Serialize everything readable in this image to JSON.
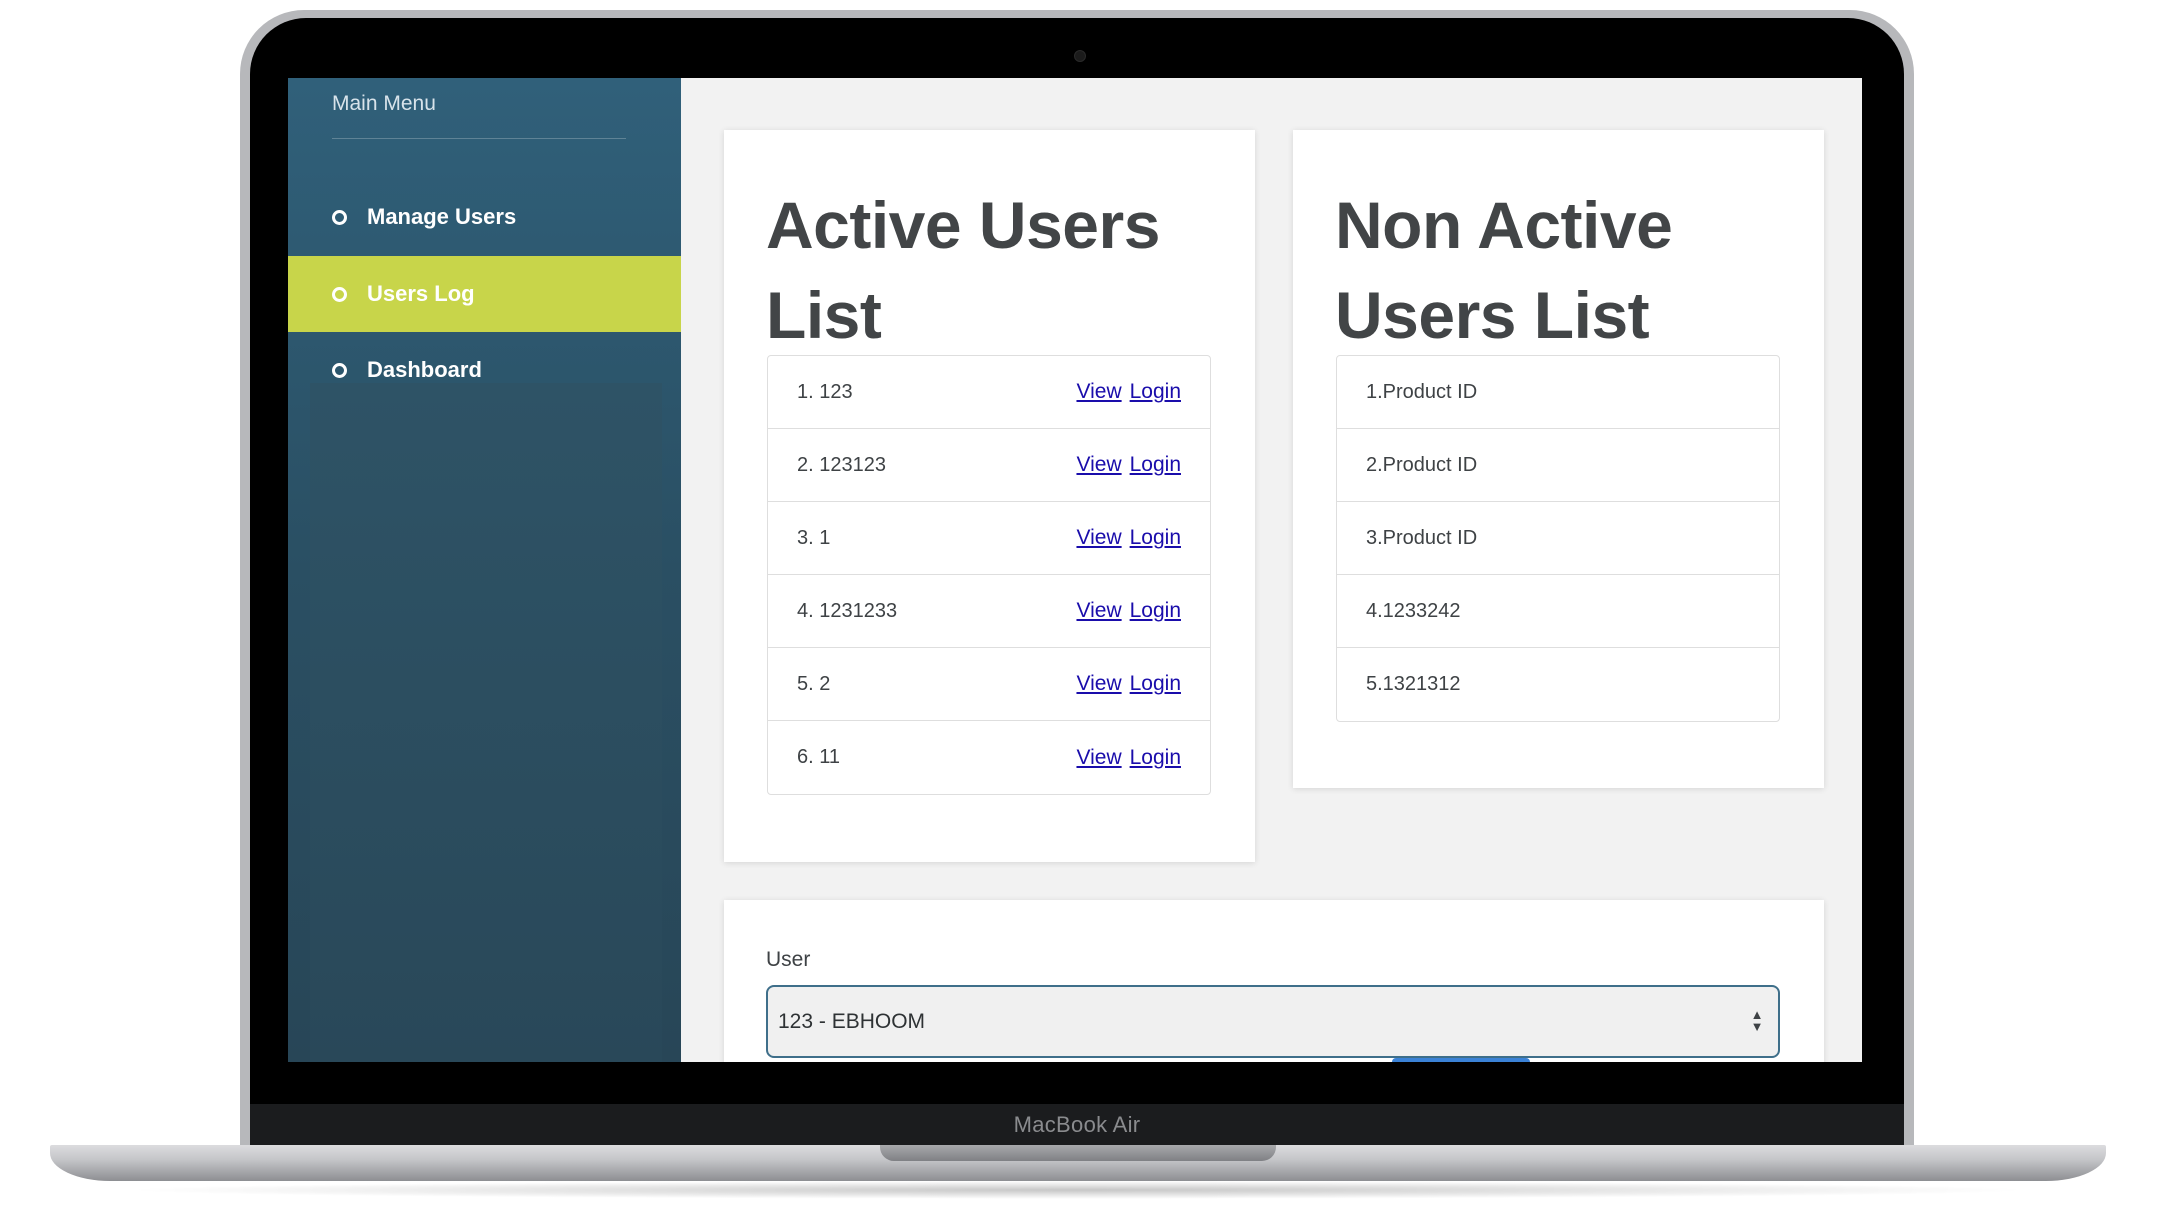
{
  "device": {
    "brand_label": "MacBook Air"
  },
  "sidebar": {
    "title": "Main Menu",
    "items": [
      {
        "label": "Manage Users",
        "active": false
      },
      {
        "label": "Users Log",
        "active": true
      },
      {
        "label": "Dashboard",
        "active": false
      }
    ],
    "colors": {
      "background": "#30607a",
      "active": "#c8d54a"
    }
  },
  "active_users": {
    "title": "Active Users List",
    "items": [
      {
        "text": "1. 123",
        "view_label": "View",
        "login_label": "Login"
      },
      {
        "text": "2. 123123",
        "view_label": "View",
        "login_label": "Login"
      },
      {
        "text": "3. 1",
        "view_label": "View",
        "login_label": "Login"
      },
      {
        "text": "4. 1231233",
        "view_label": "View",
        "login_label": "Login"
      },
      {
        "text": "5. 2",
        "view_label": "View",
        "login_label": "Login"
      },
      {
        "text": "6. 11",
        "view_label": "View",
        "login_label": "Login"
      }
    ]
  },
  "non_active_users": {
    "title": "Non Active Users List",
    "items": [
      {
        "text": "1.Product ID"
      },
      {
        "text": "2.Product ID"
      },
      {
        "text": "3.Product ID"
      },
      {
        "text": "4.1233242"
      },
      {
        "text": "5.1321312"
      }
    ]
  },
  "user_form": {
    "label": "User",
    "selected_value": "123 - EBHOOM",
    "caret_icon": "updown-chevron-icon"
  }
}
